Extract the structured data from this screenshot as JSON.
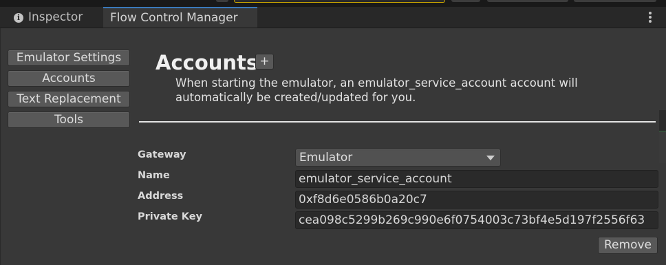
{
  "tabs": {
    "inspector_label": "Inspector",
    "flow_label": "Flow Control Manager"
  },
  "sidebar": {
    "items": [
      {
        "label": "Emulator Settings"
      },
      {
        "label": "Accounts"
      },
      {
        "label": "Text Replacement"
      },
      {
        "label": "Tools"
      }
    ]
  },
  "main": {
    "title": "Accounts",
    "add_label": "+",
    "description": "When starting the emulator, an emulator_service_account account will automatically be created/updated for you."
  },
  "form": {
    "gateway_label": "Gateway",
    "gateway_value": "Emulator",
    "name_label": "Name",
    "name_value": "emulator_service_account",
    "address_label": "Address",
    "address_value": "0xf8d6e0586b0a20c7",
    "private_key_label": "Private Key",
    "private_key_value": "cea098c5299b269c990e6f0754003c73bf4e5d197f2556f63"
  },
  "actions": {
    "remove_label": "Remove"
  },
  "colors": {
    "panel_bg": "#383838",
    "tab_accent": "#3a79bb",
    "button_bg": "#585858",
    "field_bg": "#2a2a2a"
  }
}
